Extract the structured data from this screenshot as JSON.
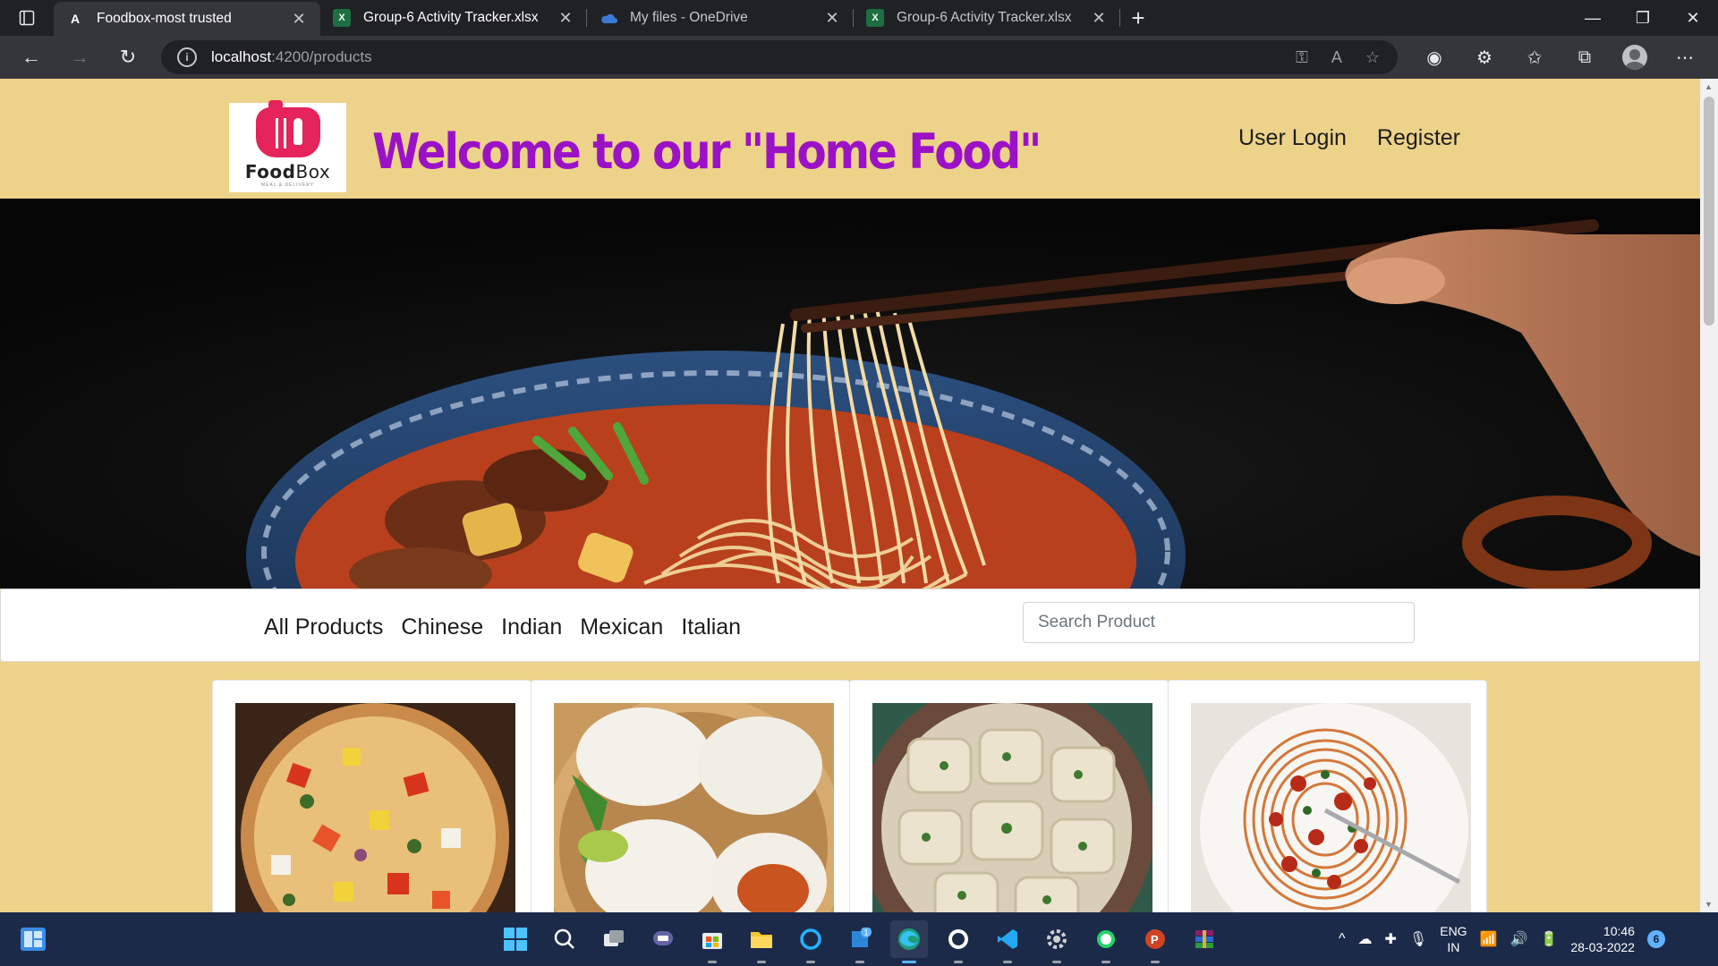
{
  "browser": {
    "tabs": [
      {
        "title": "Foodbox-most trusted",
        "favicon": "A",
        "active": true
      },
      {
        "title": "Group-6 Activity Tracker.xlsx",
        "favicon": "X",
        "active": false
      },
      {
        "title": "My files - OneDrive",
        "favicon": "cloud",
        "active": false
      },
      {
        "title": "Group-6 Activity Tracker.xlsx",
        "favicon": "X",
        "active": false
      }
    ],
    "address": {
      "host": "localhost",
      "path": ":4200/products"
    }
  },
  "site": {
    "logo": {
      "brand_bold": "Food",
      "brand_light": "Box",
      "tagline": "MEAL & DELIVERY"
    },
    "welcome": "Welcome to our \"Home Food\"",
    "nav": {
      "login": "User Login",
      "register": "Register"
    },
    "categories": [
      "All Products",
      "Chinese",
      "Indian",
      "Mexican",
      "Italian"
    ],
    "search_placeholder": "Search Product",
    "products": [
      {
        "image": "pizza"
      },
      {
        "image": "bao-buns"
      },
      {
        "image": "ravioli"
      },
      {
        "image": "spaghetti"
      }
    ],
    "colors": {
      "page_bg": "#edd28a",
      "welcome": "#9b12c6",
      "logo_red": "#e4245b"
    }
  },
  "taskbar": {
    "lang": [
      "ENG",
      "IN"
    ],
    "time": "10:46",
    "date": "28-03-2022",
    "notifications": "6"
  }
}
